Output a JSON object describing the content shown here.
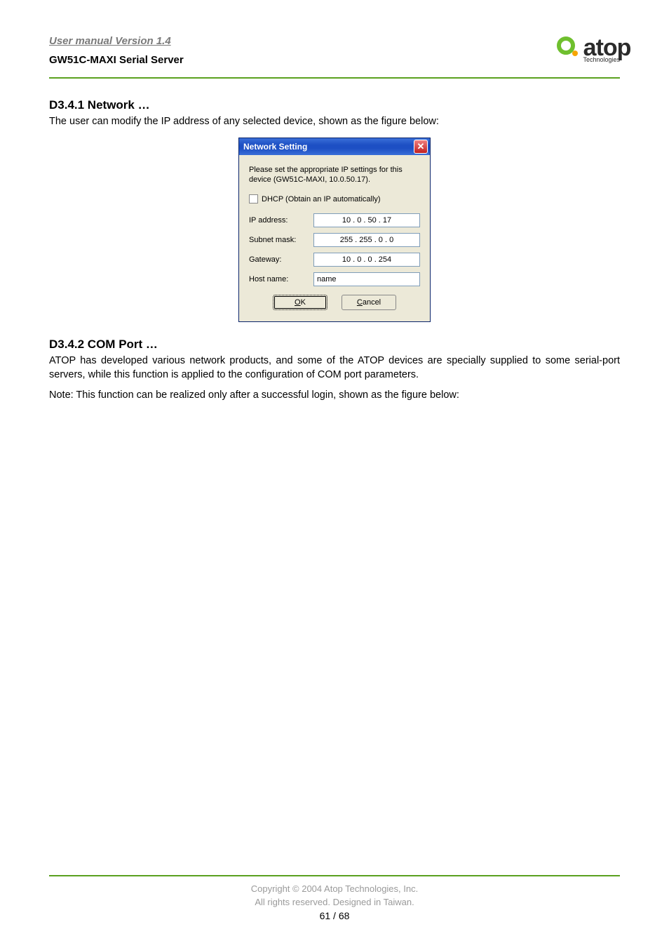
{
  "header": {
    "manual_title": "User manual Version 1.4",
    "product_title": "GW51C-MAXI Serial Server",
    "logo_text": "atop",
    "logo_sub": "Technologies"
  },
  "section1": {
    "heading": "D3.4.1 Network …",
    "para": "The user can modify the IP address of any selected device, shown as the figure below:"
  },
  "dialog": {
    "title": "Network Setting",
    "intro": "Please set the appropriate IP settings for this device (GW51C-MAXI, 10.0.50.17).",
    "dhcp_label": "DHCP (Obtain an IP automatically)",
    "ip_label": "IP address:",
    "ip_value": "10 . 0 . 50 . 17",
    "subnet_label": "Subnet mask:",
    "subnet_value": "255 . 255 . 0 . 0",
    "gateway_label": "Gateway:",
    "gateway_value": "10 . 0 . 0 . 254",
    "hostname_label": "Host name:",
    "hostname_value": "name",
    "ok_pre": "",
    "ok_ul": "O",
    "ok_post": "K",
    "cancel_pre": "",
    "cancel_ul": "C",
    "cancel_post": "ancel"
  },
  "section2": {
    "heading": "D3.4.2 COM Port …",
    "para1": "ATOP has developed various network products, and some of the ATOP devices are specially supplied to some serial-port servers, while this function is applied to the configuration of COM port parameters.",
    "para2": "Note: This function can be realized only after a successful login, shown as the figure below:"
  },
  "footer": {
    "copyright": "Copyright © 2004 Atop Technologies, Inc.",
    "rights": "All rights reserved. Designed in Taiwan.",
    "page": "61 / 68"
  }
}
